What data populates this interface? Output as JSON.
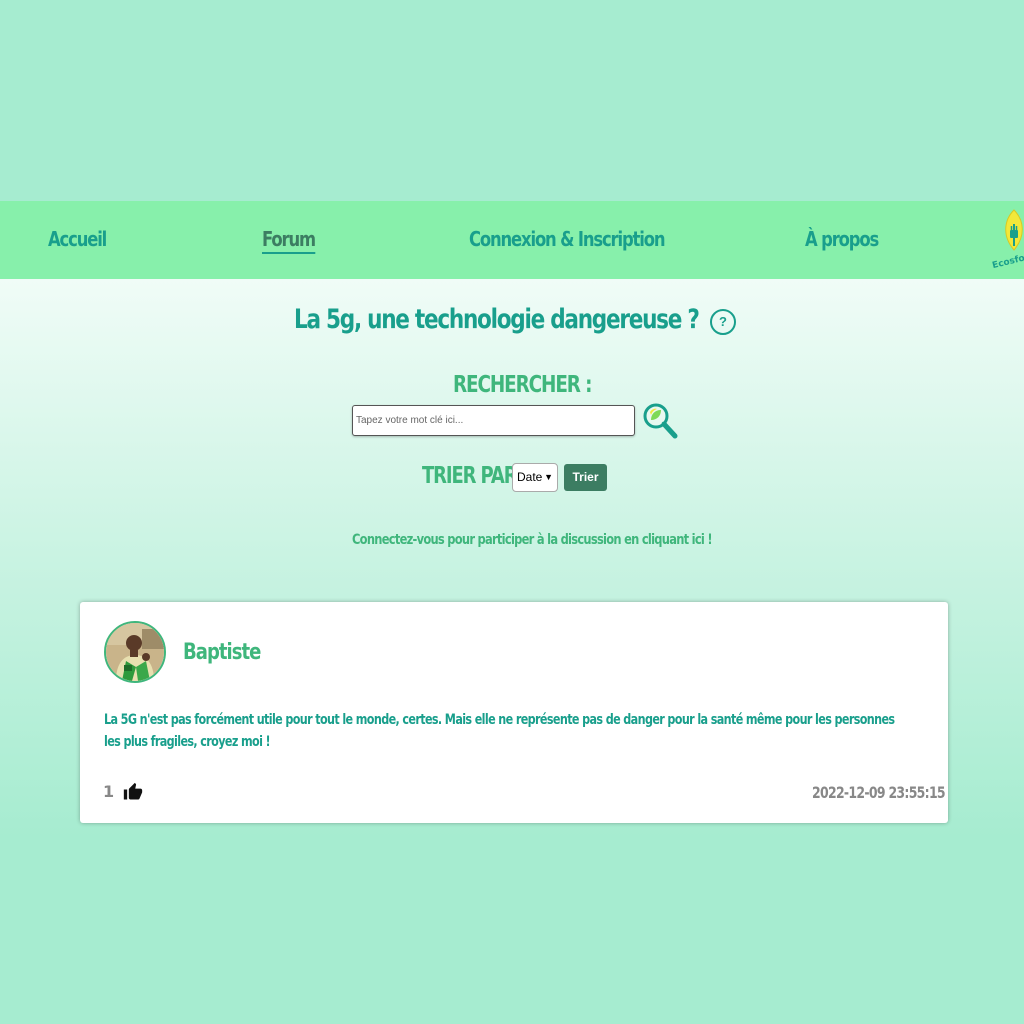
{
  "nav": {
    "items": [
      {
        "label": "Accueil",
        "active": false
      },
      {
        "label": "Forum",
        "active": true
      },
      {
        "label": "Connexion & Inscription",
        "active": false
      },
      {
        "label": "À propos",
        "active": false
      }
    ],
    "logo_text": "Ecosfo"
  },
  "topic": {
    "title": "La 5g, une technologie dangereuse ?",
    "help_glyph": "?"
  },
  "search": {
    "label": "RECHERCHER :",
    "placeholder": "Tapez votre mot clé ici..."
  },
  "sort": {
    "label": "TRIER PAR :",
    "selected": "Date",
    "button_label": "Trier"
  },
  "login_prompt": "Connectez-vous pour participer à la discussion en cliquant ici !",
  "posts": [
    {
      "author": "Baptiste",
      "body": "La 5G n'est pas forcément utile pour tout le monde, certes. Mais elle ne représente pas de danger pour la santé même pour les personnes les plus fragiles, croyez moi !",
      "likes": "1",
      "date": "2022-12-09 23:55:15"
    }
  ],
  "colors": {
    "page_bg": "#a6ecd0",
    "navbar_bg": "#87f0ab",
    "teal": "#199f8c",
    "green": "#3fb67c",
    "dark_green": "#3c7d62",
    "grey": "#888888"
  },
  "icons": {
    "help": "question-circle-icon",
    "search": "magnifier-leaf-icon",
    "like": "thumbs-up-icon",
    "select": "chevron-down-icon",
    "logo": "leaf-plug-logo"
  }
}
